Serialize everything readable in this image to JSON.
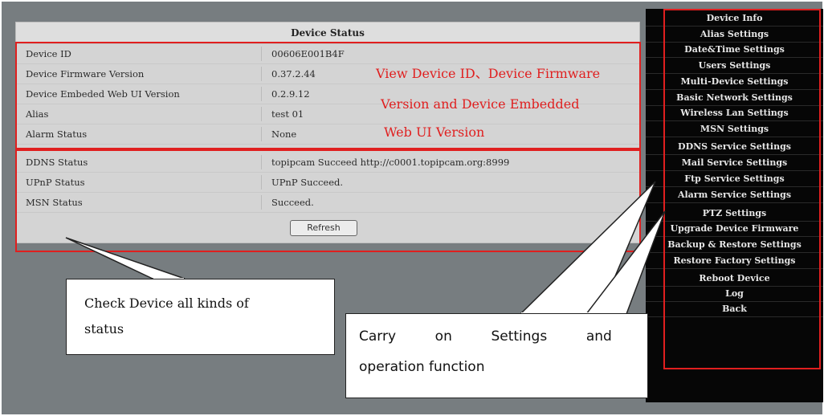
{
  "status_panel": {
    "title": "Device Status",
    "rows": [
      {
        "label": "Device ID",
        "value": "00606E001B4F"
      },
      {
        "label": "Device Firmware Version",
        "value": "0.37.2.44"
      },
      {
        "label": "Device Embeded Web UI Version",
        "value": "0.2.9.12"
      },
      {
        "label": "Alias",
        "value": "test 01"
      },
      {
        "label": "Alarm Status",
        "value": "None"
      },
      {
        "label": "DDNS Status",
        "value": "topipcam Succeed  http://c0001.topipcam.org:8999"
      },
      {
        "label": "UPnP Status",
        "value": "UPnP Succeed."
      },
      {
        "label": "MSN Status",
        "value": "Succeed."
      }
    ],
    "refresh_label": "Refresh"
  },
  "menu": {
    "items": [
      "Device Info",
      "Alias Settings",
      "Date&Time Settings",
      "Users Settings",
      "Multi-Device Settings",
      "Basic Network Settings",
      "Wireless Lan Settings",
      "MSN Settings",
      "DDNS Service Settings",
      "Mail Service Settings",
      "Ftp Service Settings",
      "Alarm Service Settings",
      "PTZ Settings",
      "Upgrade Device Firmware",
      "Backup & Restore Settings",
      "Restore Factory Settings",
      "Reboot Device",
      "Log",
      "Back"
    ]
  },
  "annotations": {
    "device_info_note": {
      "line1": "View Device ID、Device Firmware",
      "line2": "Version   and   Device   Embedded",
      "line3": "Web UI Version"
    },
    "status_callout": {
      "line1": "Check  Device  all  kinds  of",
      "line2": "status"
    },
    "settings_callout": {
      "line1": "Carry         on         Settings         and",
      "line2": "operation function"
    }
  },
  "colors": {
    "highlight_red": "#e01f1f",
    "menu_background": "#060606",
    "page_background": "#777d80"
  }
}
